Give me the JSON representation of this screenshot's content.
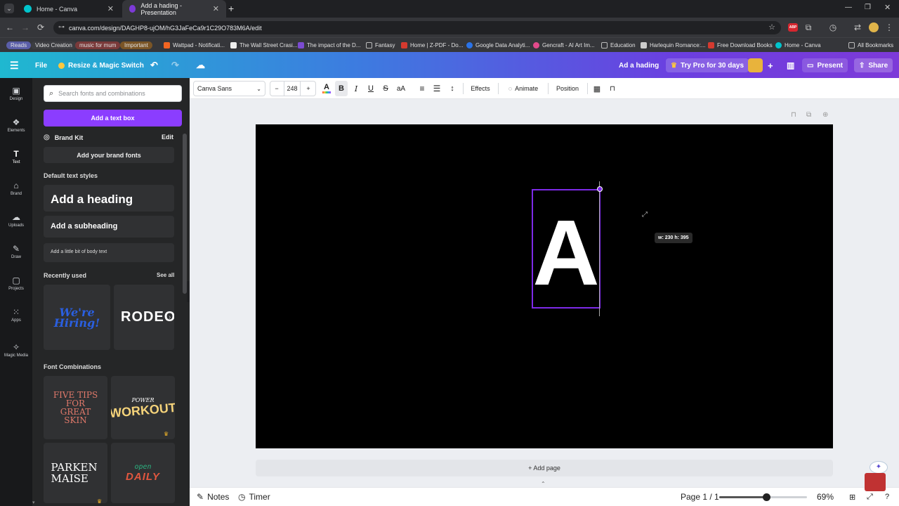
{
  "browser": {
    "tabs": [
      {
        "title": "Home - Canva",
        "active": false
      },
      {
        "title": "Add a hading - Presentation",
        "active": true
      }
    ],
    "url": "canva.com/design/DAGHP8-ujOM/hG3JaFeCa9r1C29O783M6A/edit",
    "bookmarks": [
      "Reads",
      "Video Creation",
      "music for mum",
      "Important",
      "Wattpad - Notificati...",
      "The Wall Street Crasi...",
      "The impact of the D...",
      "Fantasy",
      "Home | Z-PDF - Do...",
      "Google Data Analyti...",
      "Gencraft - AI Art Im...",
      "Education",
      "Harlequin Romance:...",
      "Free Download Books",
      "Home - Canva",
      "All Bookmarks"
    ]
  },
  "header": {
    "file": "File",
    "resize": "Resize & Magic Switch",
    "doc_title": "Ad a hading",
    "try_pro": "Try Pro for 30 days",
    "present": "Present",
    "share": "Share"
  },
  "rail": {
    "items": [
      {
        "label": "Design",
        "icon": "design-icon"
      },
      {
        "label": "Elements",
        "icon": "elements-icon"
      },
      {
        "label": "Text",
        "icon": "text-icon"
      },
      {
        "label": "Brand",
        "icon": "brand-icon"
      },
      {
        "label": "Uploads",
        "icon": "uploads-icon"
      },
      {
        "label": "Draw",
        "icon": "draw-icon"
      },
      {
        "label": "Projects",
        "icon": "projects-icon"
      },
      {
        "label": "Apps",
        "icon": "apps-icon"
      },
      {
        "label": "Magic Media",
        "icon": "magic-media-icon"
      }
    ]
  },
  "panel": {
    "search_placeholder": "Search fonts and combinations",
    "add_text_box": "Add a text box",
    "brand_kit": "Brand Kit",
    "edit": "Edit",
    "add_brand_fonts": "Add your brand fonts",
    "default_styles": "Default text styles",
    "heading": "Add a heading",
    "subheading": "Add a subheading",
    "body": "Add a little bit of body text",
    "recently_used": "Recently used",
    "see_all": "See all",
    "recent": [
      "We're Hiring!",
      "RODEO"
    ],
    "font_combinations": "Font Combinations",
    "combos": [
      "FIVE TIPS FOR GREAT SKIN",
      "POWER",
      "WORKOUT",
      "PARKEN MAISE",
      "open",
      "DAILY"
    ]
  },
  "toolbar": {
    "font": "Canva Sans",
    "size": "248",
    "minus": "−",
    "plus": "+",
    "effects": "Effects",
    "animate": "Animate",
    "position": "Position"
  },
  "canvas": {
    "letter": "A",
    "size_tip": "w: 230 h: 395",
    "add_page": "+ Add page"
  },
  "footer": {
    "notes": "Notes",
    "timer": "Timer",
    "page": "Page 1 / 1",
    "zoom_percent": 69,
    "zoom_label": "69%"
  },
  "colors": {
    "brand_purple": "#8b3dff",
    "selection": "#7d2ae8",
    "canvas_bg": "#000000"
  }
}
